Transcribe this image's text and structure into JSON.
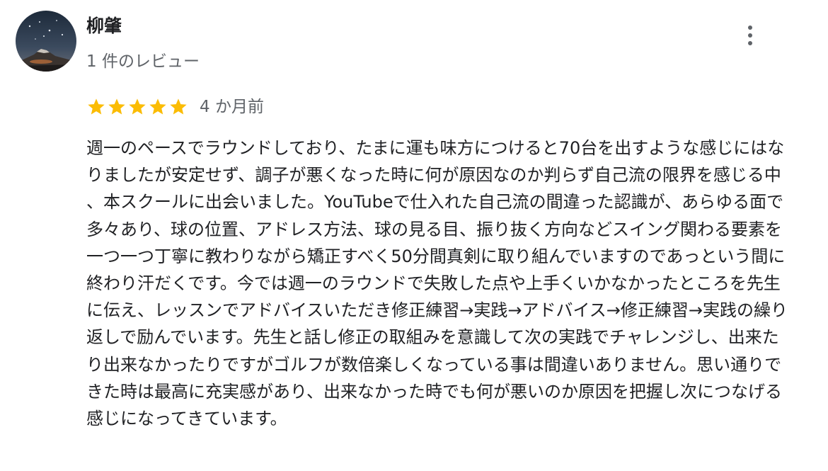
{
  "reviewer": {
    "name": "柳肇",
    "review_count_label": "1 件のレビュー"
  },
  "review": {
    "rating": 5,
    "rating_max": 5,
    "star_color": "#fbbc04",
    "date": "4 か月前",
    "text": "週一のペースでラウンドしており、たまに運も味方につけると70台を出すような感じにはなりましたが安定せず、調子が悪くなった時に何が原因なのか判らず自己流の限界を感じる中、本スクールに出会いました。YouTubeで仕入れた自己流の間違った認識が、あらゆる面で多々あり、球の位置、アドレス方法、球の見る目、振り抜く方向などスイング関わる要素を一つ一つ丁寧に教わりながら矯正すべく50分間真剣に取り組んでいますのであっという間に終わり汗だくです。今では週一のラウンドで失敗した点や上手くいかなかったところを先生に伝え、レッスンでアドバイスいただき修正練習→実践→アドバイス→修正練習→実践の繰り返しで励んでいます。先生と話し修正の取組みを意識して次の実践でチャレンジし、出来たり出来なかったりですがゴルフが数倍楽しくなっている事は間違いありません。思い通りできた時は最高に充実感があり、出来なかった時でも何が悪いのか原因を把握し次につなげる感じになってきています。"
  },
  "icons": {
    "more": "more-vert-icon",
    "star": "star-icon"
  }
}
